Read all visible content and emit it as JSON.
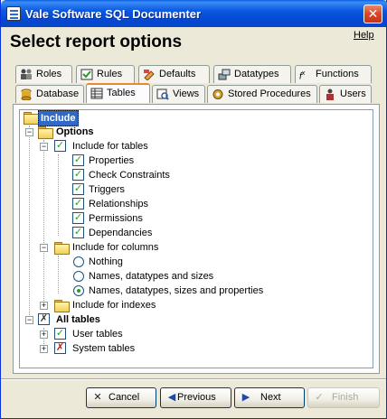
{
  "window": {
    "title": "Vale Software SQL Documenter"
  },
  "header": {
    "title": "Select report options",
    "help_label": "Help"
  },
  "tabs_row1": [
    {
      "label": "Roles",
      "icon": "roles-icon"
    },
    {
      "label": "Rules",
      "icon": "rules-icon"
    },
    {
      "label": "Defaults",
      "icon": "defaults-icon"
    },
    {
      "label": "Datatypes",
      "icon": "datatypes-icon"
    },
    {
      "label": "Functions",
      "icon": "functions-icon"
    }
  ],
  "tabs_row2": [
    {
      "label": "Database",
      "icon": "database-icon"
    },
    {
      "label": "Tables",
      "icon": "tables-icon",
      "active": true
    },
    {
      "label": "Views",
      "icon": "views-icon"
    },
    {
      "label": "Stored Procedures",
      "icon": "stored-procedures-icon"
    },
    {
      "label": "Users",
      "icon": "users-icon"
    }
  ],
  "tree": {
    "root": "Include",
    "options": "Options",
    "include_for_tables": {
      "label": "Include for tables",
      "items": [
        "Properties",
        "Check Constraints",
        "Triggers",
        "Relationships",
        "Permissions",
        "Dependancies"
      ]
    },
    "include_for_columns": {
      "label": "Include for columns",
      "choices": [
        "Nothing",
        "Names, datatypes and sizes",
        "Names, datatypes, sizes and properties"
      ],
      "selected": "Names, datatypes, sizes and properties"
    },
    "include_for_indexes": "Include for indexes",
    "all_tables": "All tables",
    "user_tables": "User tables",
    "system_tables": "System tables"
  },
  "buttons": {
    "cancel": "Cancel",
    "previous": "Previous",
    "next": "Next",
    "finish": "Finish"
  },
  "colors": {
    "title_bar": "#0a5fe0",
    "check_green": "#21a121",
    "check_red": "#d01010",
    "selection": "#316ac5",
    "active_tab_accent": "#e68b2c"
  }
}
